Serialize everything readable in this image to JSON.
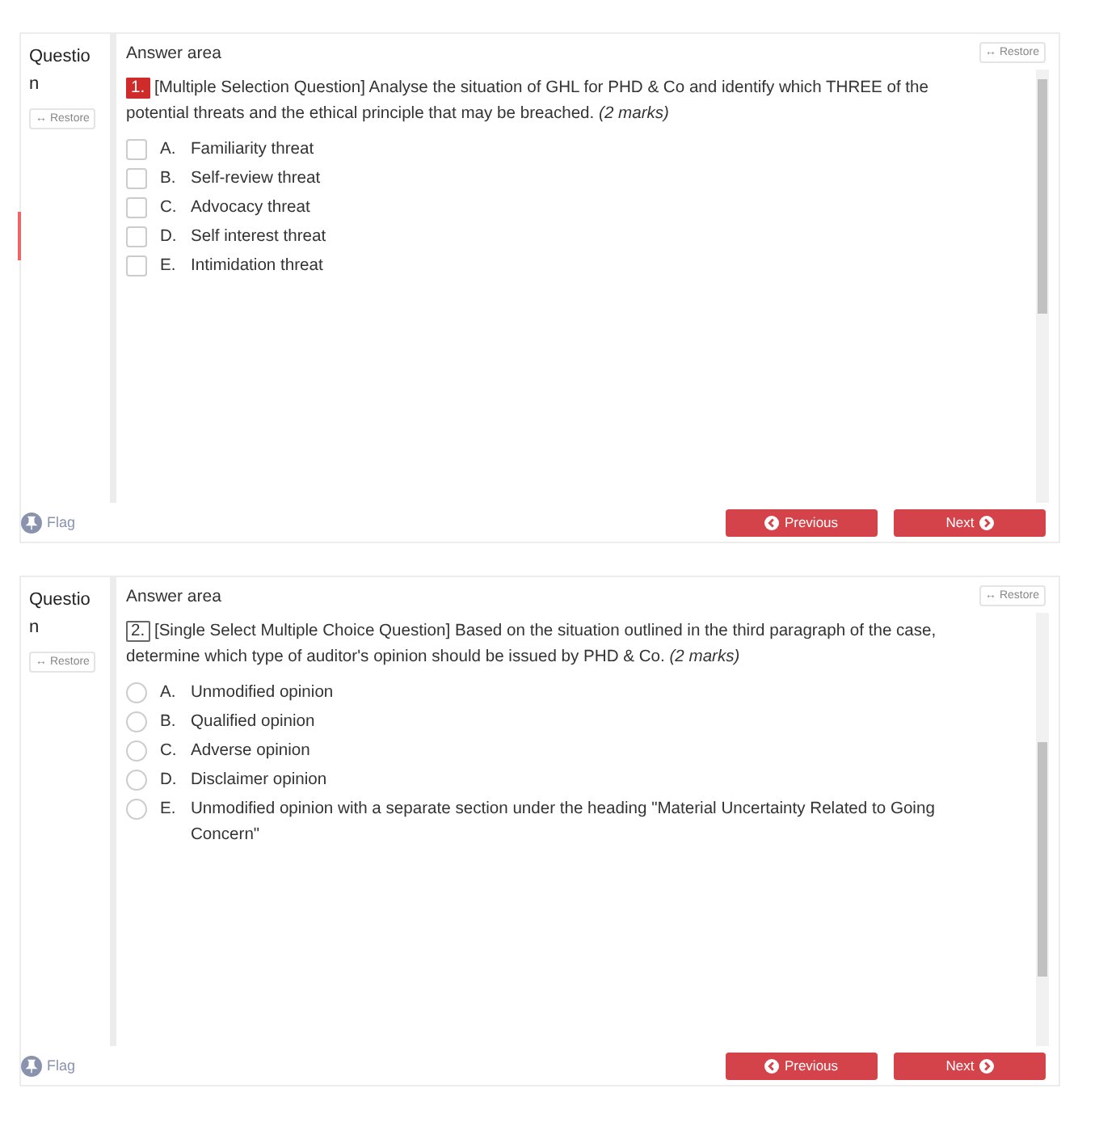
{
  "questions": [
    {
      "side_label": "Question",
      "side_restore": "↔ Restore",
      "area_label": "Answer area",
      "area_restore": "↔ Restore",
      "number": "1.",
      "number_highlighted": true,
      "prompt": "[Multiple Selection Question] Analyse the situation of GHL for PHD & Co and identify which THREE of the potential threats and the ethical principle that may be breached.",
      "marks": "(2 marks)",
      "kind": "checkbox",
      "options": [
        {
          "letter": "A.",
          "text": "Familiarity threat",
          "checked": false
        },
        {
          "letter": "B.",
          "text": "Self-review threat",
          "checked": false
        },
        {
          "letter": "C.",
          "text": "Advocacy threat",
          "checked": false
        },
        {
          "letter": "D.",
          "text": "Self interest threat",
          "checked": false
        },
        {
          "letter": "E.",
          "text": "Intimidation threat",
          "checked": false
        }
      ],
      "flag": "Flag",
      "previous": "Previous",
      "next": "Next"
    },
    {
      "side_label": "Question",
      "side_restore": "↔ Restore",
      "area_label": "Answer area",
      "area_restore": "↔ Restore",
      "number": "2.",
      "number_highlighted": false,
      "prompt": "[Single Select Multiple Choice Question] Based on the situation outlined in the third paragraph of the case, determine which type of auditor's opinion should be issued by PHD & Co.",
      "marks": "(2 marks)",
      "kind": "radio",
      "options": [
        {
          "letter": "A.",
          "text": "Unmodified opinion",
          "checked": false
        },
        {
          "letter": "B.",
          "text": "Qualified opinion",
          "checked": false
        },
        {
          "letter": "C.",
          "text": "Adverse opinion",
          "checked": false
        },
        {
          "letter": "D.",
          "text": "Disclaimer opinion",
          "checked": false
        },
        {
          "letter": "E.",
          "text": "Unmodified opinion with a separate section under the heading \"Material Uncertainty Related to Going Concern\"",
          "checked": false
        }
      ],
      "flag": "Flag",
      "previous": "Previous",
      "next": "Next"
    }
  ]
}
